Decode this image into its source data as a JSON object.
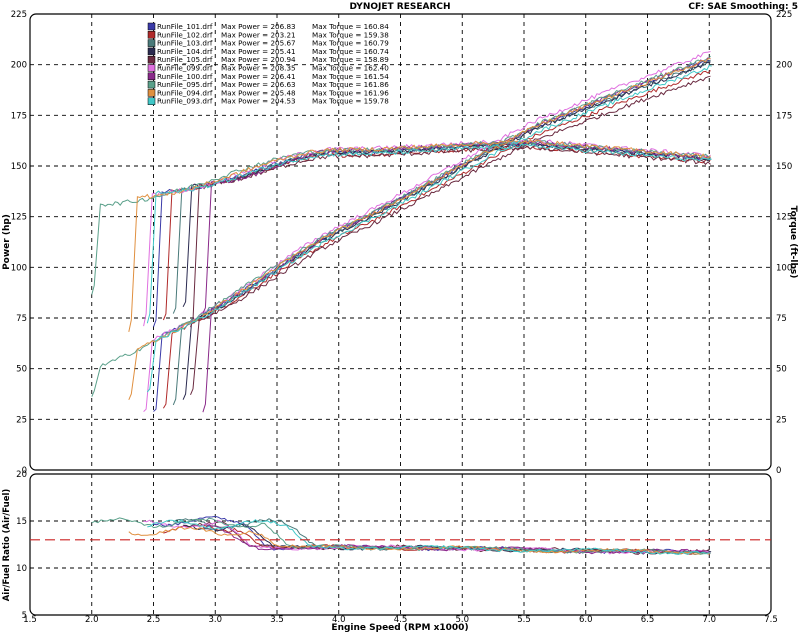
{
  "header": {
    "title": "DYNOJET RESEARCH",
    "settings": "CF: SAE  Smoothing: 5"
  },
  "chart_data": [
    {
      "type": "line",
      "panel": "power-torque",
      "xlabel": "Engine Speed (RPM x1000)",
      "ylabel_left": "Power (hp)",
      "ylabel_right": "Torque (ft-lbs)",
      "xlim": [
        1.5,
        7.5
      ],
      "ylim": [
        0,
        225
      ],
      "x_ticks": [
        "1.5",
        "2.0",
        "2.5",
        "3.0",
        "3.5",
        "4.0",
        "4.5",
        "5.0",
        "5.5",
        "6.0",
        "6.5",
        "7.0",
        "7.5"
      ],
      "y_ticks": [
        "0",
        "25",
        "50",
        "75",
        "100",
        "125",
        "150",
        "175",
        "200",
        "225"
      ],
      "grid": true,
      "legend_position": "top-left",
      "series": [
        {
          "name": "RunFile_101.drf",
          "color": "#3a3aa8",
          "max_power_label": "Max Power = 206.83",
          "max_torque_label": "Max Torque = 160.84",
          "max_power": 206.83,
          "max_torque": 160.84,
          "start_rpm": 2.5
        },
        {
          "name": "RunFile_102.drf",
          "color": "#b02a2a",
          "max_power_label": "Max Power = 203.21",
          "max_torque_label": "Max Torque = 159.38",
          "max_power": 203.21,
          "max_torque": 159.38,
          "start_rpm": 2.58
        },
        {
          "name": "RunFile_103.drf",
          "color": "#4a7a7a",
          "max_power_label": "Max Power = 205.67",
          "max_torque_label": "Max Torque = 160.79",
          "max_power": 205.67,
          "max_torque": 160.79,
          "start_rpm": 2.66
        },
        {
          "name": "RunFile_104.drf",
          "color": "#2a2a50",
          "max_power_label": "Max Power = 205.41",
          "max_torque_label": "Max Torque = 160.74",
          "max_power": 205.41,
          "max_torque": 160.74,
          "start_rpm": 2.74
        },
        {
          "name": "RunFile_105.drf",
          "color": "#6a2a40",
          "max_power_label": "Max Power = 200.94",
          "max_torque_label": "Max Torque = 158.89",
          "max_power": 200.94,
          "max_torque": 158.89,
          "start_rpm": 2.8
        },
        {
          "name": "RunFile_099.drf",
          "color": "#e070e0",
          "max_power_label": "Max Power = 208.35",
          "max_torque_label": "Max Torque = 162.40",
          "max_power": 208.35,
          "max_torque": 162.4,
          "start_rpm": 2.42
        },
        {
          "name": "RunFile_100.drf",
          "color": "#8a2a8a",
          "max_power_label": "Max Power = 206.41",
          "max_torque_label": "Max Torque = 161.54",
          "max_power": 206.41,
          "max_torque": 161.54,
          "start_rpm": 2.9
        },
        {
          "name": "RunFile_095.drf",
          "color": "#5aa08a",
          "max_power_label": "Max Power = 206.63",
          "max_torque_label": "Max Torque = 161.86",
          "max_power": 206.63,
          "max_torque": 161.86,
          "start_rpm": 2.0
        },
        {
          "name": "RunFile_094.drf",
          "color": "#e09040",
          "max_power_label": "Max Power = 205.48",
          "max_torque_label": "Max Torque = 161.96",
          "max_power": 205.48,
          "max_torque": 161.96,
          "start_rpm": 2.3
        },
        {
          "name": "RunFile_093.drf",
          "color": "#40c8c8",
          "max_power_label": "Max Power = 204.53",
          "max_torque_label": "Max Torque = 159.78",
          "max_power": 204.53,
          "max_torque": 159.78,
          "start_rpm": 2.45
        }
      ]
    },
    {
      "type": "line",
      "panel": "air-fuel",
      "xlabel": "Engine Speed (RPM x1000)",
      "ylabel": "Air/Fuel Ratio (Air/Fuel)",
      "xlim": [
        1.5,
        7.5
      ],
      "ylim": [
        5,
        20
      ],
      "x_ticks": [
        "1.5",
        "2.0",
        "2.5",
        "3.0",
        "3.5",
        "4.0",
        "4.5",
        "5.0",
        "5.5",
        "6.0",
        "6.5",
        "7.0",
        "7.5"
      ],
      "y_ticks": [
        "5",
        "10",
        "15",
        "20"
      ],
      "reference_line": 13.0,
      "reference_color": "#cc2222",
      "grid": true,
      "afr_profile": {
        "lean_value_range": [
          13.8,
          15.2
        ],
        "transition_rpm_range": [
          3.0,
          3.6
        ],
        "mid_value": 12.2,
        "end_value": 11.7
      }
    }
  ]
}
